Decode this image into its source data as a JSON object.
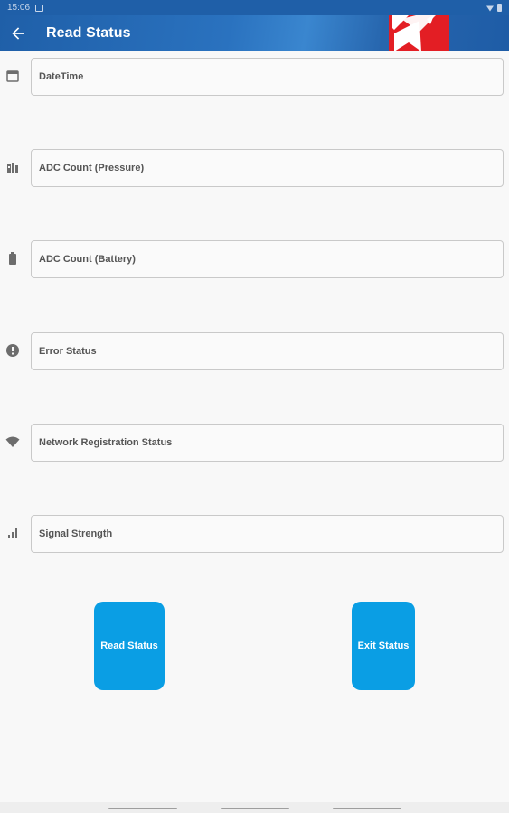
{
  "status_bar": {
    "time": "15:06"
  },
  "app_bar": {
    "title": "Read Status"
  },
  "fields": [
    {
      "label": "DateTime",
      "icon": "calendar-icon"
    },
    {
      "label": "ADC Count (Pressure)",
      "icon": "pressure-gauge-icon"
    },
    {
      "label": "ADC Count (Battery)",
      "icon": "battery-icon"
    },
    {
      "label": "Error Status",
      "icon": "error-icon"
    },
    {
      "label": "Network Registration Status",
      "icon": "wifi-icon"
    },
    {
      "label": "Signal Strength",
      "icon": "signal-bars-icon"
    }
  ],
  "buttons": {
    "read": "Read Status",
    "exit": "Exit Status"
  },
  "colors": {
    "app_bar": "#1f5fa8",
    "button": "#0a9ee4",
    "logo": "#e31e24"
  }
}
